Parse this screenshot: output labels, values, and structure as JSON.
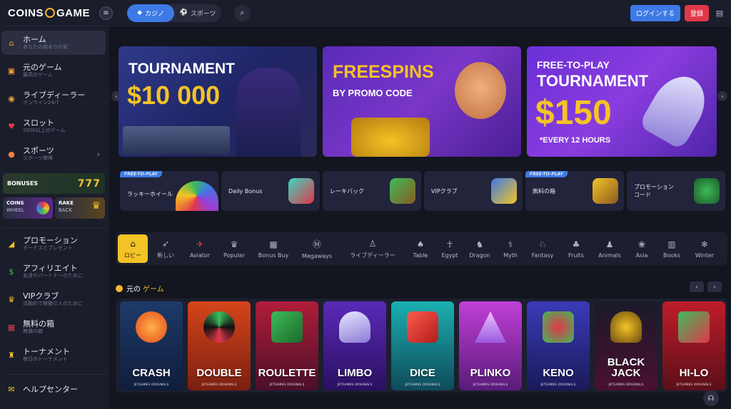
{
  "header": {
    "logo_left": "COINS",
    "logo_right": "GAME",
    "menu_icon": "hamburger-icon",
    "tabs": [
      {
        "label": "カジノ",
        "icon": "diamond-icon"
      },
      {
        "label": "スポーツ",
        "icon": "ball-icon"
      }
    ],
    "search_icon": "search-icon",
    "login": "ログインする",
    "register": "登録",
    "chat_icon": "chat-icon"
  },
  "sidebar": {
    "items": [
      {
        "title": "ホーム",
        "sub": "あなたの始まりの家",
        "icon": "home-icon"
      },
      {
        "title": "元のゲーム",
        "sub": "最高のゲーム",
        "icon": "cube-icon"
      },
      {
        "title": "ライブディーラー",
        "sub": "オンライン24/7",
        "icon": "chip-icon"
      },
      {
        "title": "スロット",
        "sub": "2000以上のゲーム",
        "icon": "slot-icon"
      },
      {
        "title": "スポーツ",
        "sub": "スポーツ賭博",
        "icon": "basketball-icon"
      }
    ],
    "bonuses_label": "BONUSES",
    "bonuses_value": "777",
    "coins_wheel": {
      "line1": "COINS",
      "line2": "WHEEL"
    },
    "rake_back": {
      "line1": "RAKE",
      "line2": "BACK"
    },
    "items2": [
      {
        "title": "プロモーション",
        "sub": "ボーナスとプレゼント",
        "icon": "megaphone-icon"
      },
      {
        "title": "アフィリエイト",
        "sub": "友達やパートナーのために",
        "icon": "affiliate-icon"
      },
      {
        "title": "VIPクラブ",
        "sub": "活動的で稼働な人のために",
        "icon": "crown-icon"
      },
      {
        "title": "無料の箱",
        "sub": "無償の箱",
        "icon": "gift-icon"
      },
      {
        "title": "トーナメント",
        "sub": "毎日のトーナメント",
        "icon": "trophy-icon"
      }
    ],
    "help": {
      "title": "ヘルプセンター",
      "icon": "help-chat-icon"
    }
  },
  "banners": [
    {
      "line1": "TOURNAMENT",
      "line2": "$10 000"
    },
    {
      "line1": "FREESPINS",
      "line2": "BY PROMO CODE"
    },
    {
      "line1": "FREE-TO-PLAY",
      "line2": "TOURNAMENT",
      "line3": "$150",
      "line4": "*EVERY 12 HOURS"
    }
  ],
  "quick_tiles": [
    {
      "label": "ラッキーホイール",
      "tag": "FREE-TO-PLAY"
    },
    {
      "label": "Daily Bonus",
      "tag": ""
    },
    {
      "label": "レーキバック",
      "tag": ""
    },
    {
      "label": "VIPクラブ",
      "tag": ""
    },
    {
      "label": "無料の箱",
      "tag": "FREE-TO-PLAY"
    },
    {
      "label": "プロモーションコード",
      "tag": ""
    }
  ],
  "categories": [
    {
      "label": "ロビー",
      "icon": "lobby-icon"
    },
    {
      "label": "新しい",
      "icon": "rocket-icon"
    },
    {
      "label": "Aviator",
      "icon": "plane-icon"
    },
    {
      "label": "Popular",
      "icon": "crown-icon"
    },
    {
      "label": "Bonus Buy",
      "icon": "gift-icon"
    },
    {
      "label": "Megaways",
      "icon": "m-icon"
    },
    {
      "label": "ライブディーラー",
      "icon": "dealer-icon"
    },
    {
      "label": "Table",
      "icon": "cards-icon"
    },
    {
      "label": "Egypt",
      "icon": "ankh-icon"
    },
    {
      "label": "Dragon",
      "icon": "dragon-icon"
    },
    {
      "label": "Myth",
      "icon": "myth-icon"
    },
    {
      "label": "Fantasy",
      "icon": "unicorn-icon"
    },
    {
      "label": "Fruits",
      "icon": "cherry-icon"
    },
    {
      "label": "Animals",
      "icon": "dog-icon"
    },
    {
      "label": "Asia",
      "icon": "lotus-icon"
    },
    {
      "label": "Books",
      "icon": "book-icon"
    },
    {
      "label": "Winter",
      "icon": "snowflake-icon"
    }
  ],
  "section": {
    "title_white": "元の",
    "title_yellow": "ゲーム"
  },
  "games": [
    {
      "name": "CRASH",
      "studio": "JETGAMES ORIGINALS"
    },
    {
      "name": "DOUBLE",
      "studio": "JETGAMES ORIGINALS"
    },
    {
      "name": "ROULETTE",
      "studio": "JETGAMES ORIGINALS"
    },
    {
      "name": "LIMBO",
      "studio": "JETGAMES ORIGINALS"
    },
    {
      "name": "DICE",
      "studio": "JETGAMES ORIGINALS"
    },
    {
      "name": "PLINKO",
      "studio": "JETGAMES ORIGINALS"
    },
    {
      "name": "KENO",
      "studio": "JETGAMES ORIGINALS"
    },
    {
      "name": "BLACK JACK",
      "studio": "JETGAMES ORIGINALS"
    },
    {
      "name": "HI-LO",
      "studio": "JETGAMES ORIGINALS"
    }
  ],
  "colors": {
    "accent": "#3d7ae6",
    "register": "#e2374a",
    "gold": "#f4c325"
  }
}
